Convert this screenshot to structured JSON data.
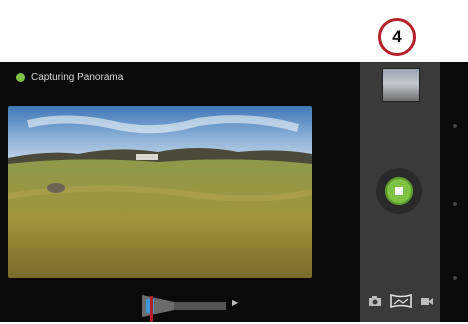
{
  "status": {
    "text": "Capturing Panorama",
    "indicator_color": "#7dc242"
  },
  "callout": {
    "number": "4",
    "color": "#b3202a"
  },
  "controls": {
    "shutter_icon": "stop-icon",
    "shutter_color": "#7dc242",
    "modes": [
      "camera-icon",
      "panorama-icon",
      "video-icon"
    ]
  },
  "panorama_progress": {
    "icon": "panorama-progress-indicator",
    "fraction": 0.1,
    "indicator_color": "#3a9ad9"
  }
}
